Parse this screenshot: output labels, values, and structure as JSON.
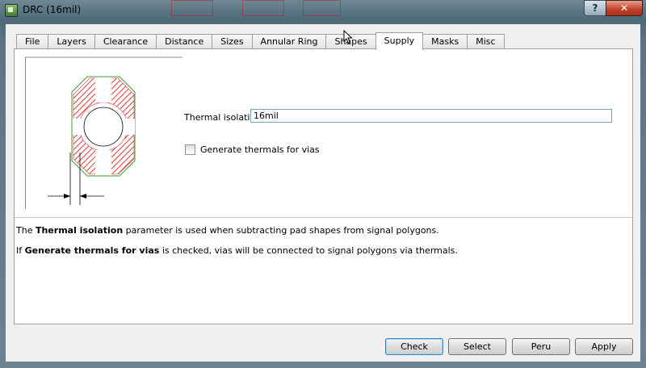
{
  "window": {
    "title": "DRC (16mil)",
    "help_glyph": "?",
    "close_glyph": "✕"
  },
  "tabs": [
    {
      "label": "File"
    },
    {
      "label": "Layers"
    },
    {
      "label": "Clearance"
    },
    {
      "label": "Distance"
    },
    {
      "label": "Sizes"
    },
    {
      "label": "Annular Ring"
    },
    {
      "label": "Shapes"
    },
    {
      "label": "Supply"
    },
    {
      "label": "Masks"
    },
    {
      "label": "Misc"
    }
  ],
  "active_tab": "Supply",
  "form": {
    "thermal_isolation_label": "Thermal isolation",
    "thermal_isolation_value": "16mil",
    "generate_thermals_label": "Generate thermals for vias",
    "generate_thermals_checked": false
  },
  "description": {
    "line1_pre": "The ",
    "line1_bold": "Thermal isolation",
    "line1_post": " parameter is used when subtracting pad shapes from signal polygons.",
    "line2_pre": "If ",
    "line2_bold": "Generate thermals for vias",
    "line2_post": " is checked, vias will be connected to signal polygons via thermals."
  },
  "buttons": {
    "check": "Check",
    "select": "Select",
    "peru": "Peru",
    "apply": "Apply"
  },
  "colors": {
    "hatch": "#e03a3a",
    "outline": "#3a9a3a",
    "accent_border": "#3c7fb1"
  }
}
